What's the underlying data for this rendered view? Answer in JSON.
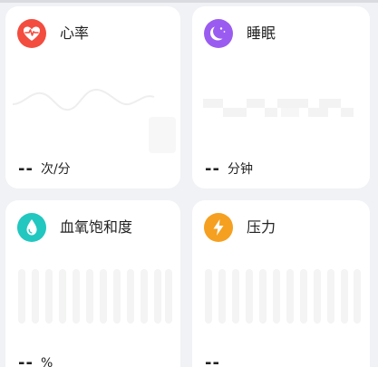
{
  "cards": {
    "heart_rate": {
      "title": "心率",
      "value": "--",
      "unit": "次/分",
      "icon": "heart-pulse-icon",
      "accent": "#f24d3f"
    },
    "sleep": {
      "title": "睡眠",
      "value": "--",
      "unit": "分钟",
      "icon": "moon-icon",
      "accent": "#9a5cf0"
    },
    "spo2": {
      "title": "血氧饱和度",
      "value": "--",
      "unit": "%",
      "icon": "water-drop-icon",
      "accent": "#22c7c0"
    },
    "stress": {
      "title": "压力",
      "value": "--",
      "unit": "",
      "icon": "lightning-icon",
      "accent": "#f5a020"
    }
  },
  "colors": {
    "page_background": "#f1f2f5",
    "card_background": "#ffffff",
    "placeholder_line": "#eeeeee",
    "placeholder_bar": "#f3f4f3"
  }
}
